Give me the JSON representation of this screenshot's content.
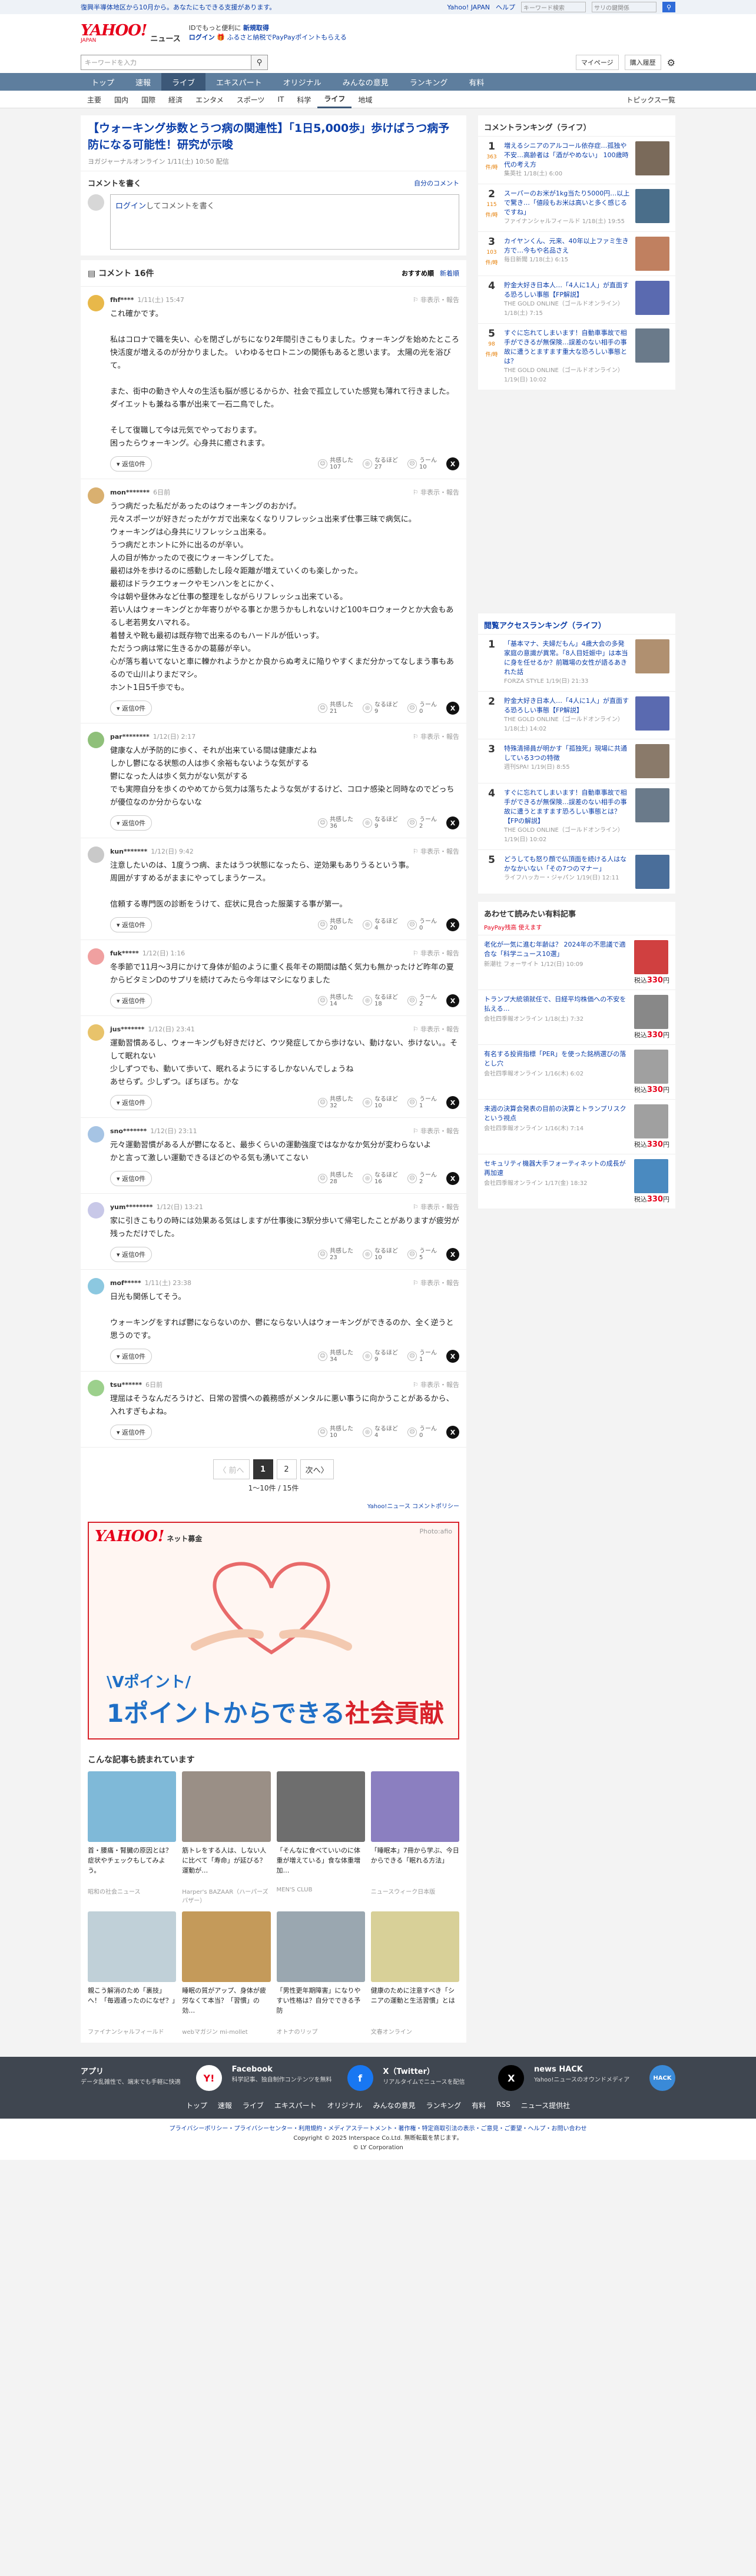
{
  "topnote": {
    "left": "復興半導体地区から10月から。あなたにもできる支援があります。",
    "link": "Yahoo! JAPAN",
    "help": "ヘルプ",
    "search_placeholder": "キーワード検索",
    "search_value": "サリの鍵関係"
  },
  "header": {
    "logo": "YAHOO!",
    "logo_sub": "JAPAN",
    "service": "ニュース",
    "promo_line1": "IDでもっと便利に",
    "promo_new": "新規取得",
    "promo_login": "ログイン",
    "promo_line2": "ふるさと納税でPayPayポイントもらえる"
  },
  "search": {
    "placeholder": "キーワードを入力",
    "mypage": "マイページ",
    "purchase": "購入履歴"
  },
  "gnav": [
    "トップ",
    "速報",
    "ライブ",
    "エキスパート",
    "オリジナル",
    "みんなの意見",
    "ランキング",
    "有料"
  ],
  "snav": [
    "主要",
    "国内",
    "国際",
    "経済",
    "エンタメ",
    "スポーツ",
    "IT",
    "科学",
    "ライフ",
    "地域"
  ],
  "snav_active": 8,
  "snav_right": "トピックス一覧",
  "article": {
    "title": "【ウォーキング歩数とうつ病の関連性】「1日5,000歩」歩けばうつ病予防になる可能性！研究が示唆",
    "source": "ヨガジャーナルオンライン",
    "date": "1/11(土) 10:50 配信"
  },
  "write": {
    "title": "コメントを書く",
    "policy_link": "自分のコメント",
    "login_link": "ログイン",
    "placeholder": "してコメントを書く"
  },
  "comments_head": {
    "label": "コメント 16件",
    "sort_on": "おすすめ順",
    "sort_off": "新着順"
  },
  "react_labels": {
    "agree": "共感した",
    "hmm": "なるほど",
    "nope": "うーん",
    "reply": "返信"
  },
  "comments": [
    {
      "user": "fhf****",
      "date": "1/11(土) 15:47",
      "text": "これ確かです。\n\n私はコロナで職を失い、心を閉ざしがちになり2年間引きこもりました。ウォーキングを始めたところ快活度が増えるのが分かりました。 いわゆるセロトニンの関係もあると思います。 太陽の光を浴びて。\n\nまた、街中の動きや人々の生活も脳が感じるからか、社会で孤立していた感覚も薄れて行きました。\nダイエットも兼ねる事が出来て一石二鳥でした。\n\nそして復職して今は元気でやっております。\n困ったらウォーキング。心身共に癒されます。",
      "replies": "返信0件",
      "agree": "107",
      "hmm": "27",
      "nope": "10",
      "color": "#e8b84a"
    },
    {
      "user": "mon*******",
      "date": "6日前",
      "text": "うつ病だった私だがあったのはウォーキングのおかげ。\n元々スポーツが好きだったがケガで出来なくなりリフレッシュ出来ず仕事三昧で病気に。\nウォーキングは心身共にリフレッシュ出来る。\nうつ病だとホントに外に出るのが辛い。\n人の目が怖かったので夜にウォーキングしてた。\n最初は外を歩けるのに感動したし段々距離が増えていくのも楽しかった。\n最初はドラクエウォークやモンハンをとにかく、\n今は朝や昼休みなど仕事の整理をしながらリフレッシュ出来ている。\n若い人はウォーキングとか年寄りがやる事とか思うかもしれないけど100キロウォークとか大会もあるし老若男女ハマれる。\n着替えや靴も最初は既存物で出来るのもハードルが低いっす。\nただうつ病は常に生きるかの葛藤が辛い。\n心が落ち着いてないと車に轢かれようかとか良からぬ考えに陥りやすくまだ分かってなしまう事もあるので山川よりまだマシ。\nホント1日5千歩でも。",
      "replies": "返信0件",
      "agree": "21",
      "hmm": "9",
      "nope": "0",
      "color": "#d9b070"
    },
    {
      "user": "par********",
      "date": "1/12(日) 2:17",
      "text": "健康な人が予防的に歩く、それが出来ている間は健康だよね\nしかし鬱になる状態の人は歩く余裕もないような気がする\n鬱になった人は歩く気力がない気がする\nでも実際自分を歩くのやめてから気力は落ちたような気がするけど、コロナ感染と同時なのでどっちが優位なのか分からないな",
      "replies": "返信0件",
      "agree": "36",
      "hmm": "9",
      "nope": "2",
      "color": "#8fc07a"
    },
    {
      "user": "kun*******",
      "date": "1/12(日) 9:42",
      "text": "注意したいのは、1度うつ病、またはうつ状態になったら、逆効果もありうるという事。\n周囲がすすめるがままにやってしまうケース。\n\n信頼する専門医の診断をうけて、症状に見合った服薬する事が第一。",
      "replies": "返信0件",
      "agree": "20",
      "hmm": "4",
      "nope": "0",
      "color": "#c9c9c9"
    },
    {
      "user": "fuk*****",
      "date": "1/12(日) 1:16",
      "text": "冬季節で11月〜3月にかけて身体が鉛のように重く長年その期間は酷く気力も無かったけど昨年の夏からビタミンDのサプリを続けてみたら今年はマシになりました",
      "replies": "返信0件",
      "agree": "14",
      "hmm": "18",
      "nope": "2",
      "color": "#f0a0a0"
    },
    {
      "user": "jus*******",
      "date": "1/12(日) 23:41",
      "text": "運動習慣あるし、ウォーキングも好きだけど、ウツ発症してから歩けない、動けない、歩けない。。そして眠れない\n少しずつでも、動いて歩いて、眠れるようにするしかないんでしょうね\nあせらず。少しずつ。ぼちぼち。かな",
      "replies": "返信0件",
      "agree": "32",
      "hmm": "10",
      "nope": "1",
      "color": "#e8c36b"
    },
    {
      "user": "sno*******",
      "date": "1/12(日) 23:11",
      "text": "元々運動習慣がある人が鬱になると、最歩くらいの運動強度ではなかなか気分が変わらないよ\nかと言って激しい運動できるほどのやる気も湧いてこない",
      "replies": "返信0件",
      "agree": "28",
      "hmm": "16",
      "nope": "2",
      "color": "#a6c4e4"
    },
    {
      "user": "yum********",
      "date": "1/12(日) 13:21",
      "text": "家に引きこもりの時には効果ある気はしますが仕事後に3駅分歩いて帰宅したことがありますが疲労が残っただけでした。",
      "replies": "返信0件",
      "agree": "23",
      "hmm": "10",
      "nope": "5",
      "color": "#c8c8e8"
    },
    {
      "user": "mof*****",
      "date": "1/11(土) 23:38",
      "text": "日光も関係してそう。\n\nウォーキングをすれば鬱にならないのか、鬱にならない人はウォーキングができるのか、全く逆うと思うのです。",
      "replies": "返信0件",
      "agree": "34",
      "hmm": "9",
      "nope": "1",
      "color": "#8cc8e0"
    },
    {
      "user": "tsu******",
      "date": "6日前",
      "text": "理屈はそうなんだろうけど、日常の習慣への義務感がメンタルに悪い事うに向かうことがあるから、入れすぎもよね。",
      "replies": "返信0件",
      "agree": "10",
      "hmm": "4",
      "nope": "0",
      "color": "#9cd08c"
    }
  ],
  "pager": {
    "prev": "〈 前へ",
    "pages": [
      "1",
      "2"
    ],
    "current": "1",
    "next": "次へ〉",
    "count": "1〜10件 / 15件"
  },
  "policy": "Yahoo!ニュース コメントポリシー",
  "ad": {
    "logo": "YAHOO!",
    "logo_sub": "ネット募金",
    "photo": "Photo:afio",
    "line1": "\\Vポイント/",
    "line2_a": "1ポイントからできる",
    "line2_b": "社会貢献"
  },
  "recs": {
    "title": "こんな記事も読まれています",
    "items": [
      {
        "title": "首・腰痛・腎臓の原因とは？症状やチェックもしてみよう。",
        "src": "昭和の社会ニュース",
        "color": "#7fb9d8"
      },
      {
        "title": "筋トレをする人は、しない人に比べて「寿命」が延びる？運動が…",
        "src": "Harper's BAZAAR（ハーパーズ バザー）",
        "color": "#9a8f86"
      },
      {
        "title": "「そんなに食べていいのに体重が増えている」食な体重増加…",
        "src": "MEN'S CLUB",
        "color": "#6e6e6e"
      },
      {
        "title": "「睡眠本」7冊から学ぶ、今日からできる「眠れる方法」",
        "src": "ニュースウィーク日本版",
        "color": "#8b7fc0"
      },
      {
        "title": "親こう解消のため「裏技」へ！「毎週通ったのになぜ？」",
        "src": "ファイナンシャルフィールド",
        "color": "#c0d0d8"
      },
      {
        "title": "睡眠の質がアップ、身体が疲労なくて本当？「習慣」の効…",
        "src": "webマガジン mi-mollet",
        "color": "#c49a5a"
      },
      {
        "title": "「男性更年期障害」になりやすい性格は？自分でできる予防",
        "src": "オトナのリップ",
        "color": "#9aa7b0"
      },
      {
        "title": "健康のために注意すべき「シニアの運動と生活習慣」とは",
        "src": "文春オンライン",
        "color": "#d8d098"
      }
    ]
  },
  "side_rank": {
    "title": "コメントランキング（ライフ）",
    "items": [
      {
        "rank": "1",
        "count": "363",
        "unit": "件/時",
        "title": "増えるシニアのアルコール依存症…孤独や不安…高齢者は「酒がやめない」 100歳時代の考え方",
        "src": "集英社 1/18(土) 6:00",
        "color": "#7a6a5a"
      },
      {
        "rank": "2",
        "count": "115",
        "unit": "件/時",
        "title": "スーパーのお米が1kg当たり5000円…以上で驚き…「値段もお米は高いと多く感じるですね」",
        "src": "ファイナンシャルフィールド 1/18(土) 19:55",
        "color": "#4a6e8a"
      },
      {
        "rank": "3",
        "count": "103",
        "unit": "件/時",
        "title": "カイヤンくん、元来、40年以上ファミ生き方で…今もや名品さえ",
        "src": "毎日新聞 1/18(土) 6:15",
        "color": "#c08060"
      },
      {
        "rank": "4",
        "count": "",
        "unit": "",
        "title": "貯金大好き日本人…「4人に1人」が直面する恐ろしい事態【FP解説】",
        "src": "THE GOLD ONLINE（ゴールドオンライン） 1/18(土) 7:15",
        "color": "#5a6ab0"
      },
      {
        "rank": "5",
        "count": "98",
        "unit": "件/時",
        "title": "すぐに忘れてしまいます！自動車事故で相手ができるが無保険…誤差のない相手の事故に遭うとますます重大な恐ろしい事態とは？",
        "src": "THE GOLD ONLINE（ゴールドオンライン） 1/19(日) 10:02",
        "color": "#6a7a8a"
      }
    ]
  },
  "side_access": {
    "title": "閲覧アクセスランキング（ライフ）",
    "items": [
      {
        "rank": "1",
        "title": "「基本マナ、夫婦だもん」4歳大会の多発家庭の意識が異常。「8人目妊娠中」は本当に身を任せるか？前職場の女性が語るあきれた話",
        "src": "FORZA STYLE 1/19(日) 21:33",
        "color": "#b09070"
      },
      {
        "rank": "2",
        "title": "貯金大好き日本人…「4人に1人」が直面する恐ろしい事態【FP解説】",
        "src": "THE GOLD ONLINE（ゴールドオンライン） 1/18(土) 14:02",
        "color": "#5a6ab0"
      },
      {
        "rank": "3",
        "title": "特殊清掃員が明かす「孤独死」現場に共通している3つの特徴",
        "src": "週刊SPA! 1/19(日) 8:55",
        "color": "#8a7a6a"
      },
      {
        "rank": "4",
        "title": "すぐに忘れてしまいます！自動車事故で相手ができるが無保険…誤差のない相手の事故に遭うとますます恐ろしい事態とは？【FPの解説】",
        "src": "THE GOLD ONLINE（ゴールドオンライン） 1/19(日) 10:02",
        "color": "#6a7a8a"
      },
      {
        "rank": "5",
        "title": "どうしても怒り顔で仏頂面を続ける人はなかなかいない「その7つのマナー」",
        "src": "ライフハッカー・ジャパン 1/19(日) 12:11",
        "color": "#4a6e9a"
      }
    ]
  },
  "side_pp": {
    "title": "あわせて読みたい有料記事",
    "badge": "PayPay残高 使えます",
    "items": [
      {
        "title": "老化が一気に進む年齢は？ 2024年の不思議で適合な「科学ニュース10選」",
        "src": "新潮社 フォーサイト 1/12(日) 10:09",
        "price": "330",
        "color": "#d04040"
      },
      {
        "title": "トランプ大統領就任で、日経平均株価への不安を払える…",
        "src": "会社四季報オンライン 1/18(土) 7:32",
        "price": "330",
        "color": "#888"
      },
      {
        "title": "有名する投資指標「PER」を使った銘柄選びの落とし穴",
        "src": "会社四季報オンライン 1/16(木) 6:02",
        "price": "330",
        "color": "#a0a0a0"
      },
      {
        "title": "来週の決算会発表の目前の決算とトランプリスクという視点",
        "src": "会社四季報オンライン 1/16(木) 7:14",
        "price": "330",
        "color": "#a0a0a0"
      },
      {
        "title": "セキュリティ機器大手フォーティネットの成長が再加速",
        "src": "会社四季報オンライン 1/17(金) 18:32",
        "price": "330",
        "color": "#4a8ac0"
      }
    ],
    "price_prefix": "税込",
    "price_suffix": "円"
  },
  "footer": {
    "apps": [
      {
        "name": "アプリ",
        "desc": "データ乱雑性で、端末でも手軽に快適",
        "icon": "Y!",
        "bg": "#fff",
        "fg": "#e6001a"
      },
      {
        "name": "Facebook",
        "desc": "科学記事、独自制作コンテンツを無料",
        "icon": "f",
        "bg": "#1877f2",
        "fg": "#fff"
      },
      {
        "name": "X（Twitter）",
        "desc": "リアルタイムでニュースを配信",
        "icon": "X",
        "bg": "#000",
        "fg": "#fff"
      },
      {
        "name": "news HACK",
        "desc": "Yahoo!ニュースのオウンドメディア",
        "icon": "HACK",
        "bg": "#3a8ad8",
        "fg": "#fff"
      }
    ],
    "nav": [
      "トップ",
      "速報",
      "ライブ",
      "エキスパート",
      "オリジナル",
      "みんなの意見",
      "ランキング",
      "有料",
      "RSS",
      "ニュース提供社"
    ]
  },
  "legal": {
    "line1": "プライバシーポリシー・プライバシーセンター・利用規約・メディアステートメント・著作権・特定商取引法の表示・ご意見・ご要望・ヘルプ・お問い合わせ",
    "line2": "Copyright © 2025 Interspace Co.Ltd. 無断転載を禁じます。",
    "line3": "© LY Corporation"
  }
}
